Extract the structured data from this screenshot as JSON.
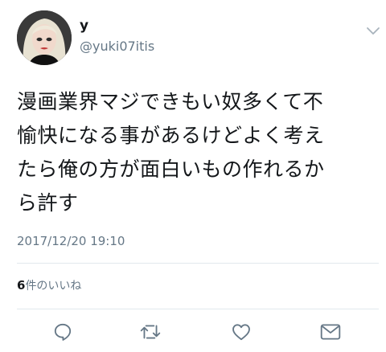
{
  "user": {
    "display_name": "y",
    "handle": "@yuki07itis",
    "avatar_icon": "user-avatar"
  },
  "tweet": {
    "text_lines": [
      "漫画業界マジできもい奴多くて不",
      "愉快になる事があるけどよく考え",
      "たら俺の方が面白いもの作れるか",
      "ら許す"
    ],
    "timestamp": "2017/12/20 19:10"
  },
  "stats": {
    "likes_count": "6",
    "likes_label": "件のいいね"
  },
  "actions": [
    {
      "name": "reply",
      "icon": "reply-icon"
    },
    {
      "name": "retweet",
      "icon": "retweet-icon"
    },
    {
      "name": "like",
      "icon": "heart-icon"
    },
    {
      "name": "direct-message",
      "icon": "envelope-icon"
    }
  ],
  "colors": {
    "text": "#14171a",
    "secondary": "#657786",
    "divider": "#e1e8ed",
    "icon": "#657786"
  }
}
